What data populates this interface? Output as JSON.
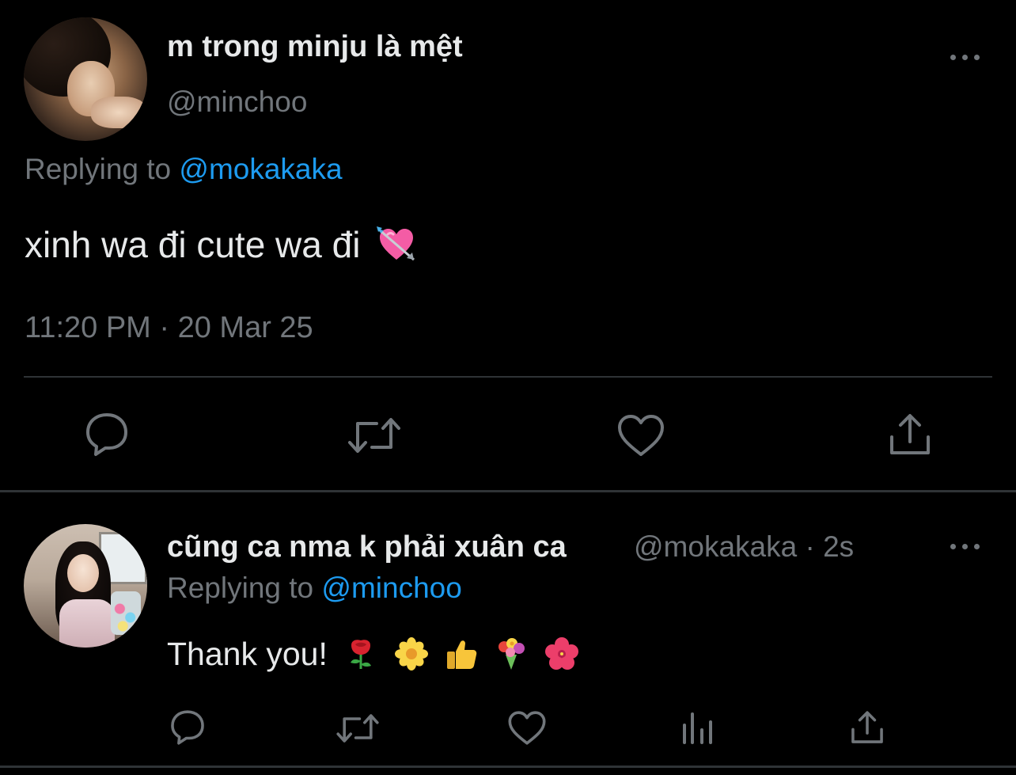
{
  "main_tweet": {
    "display_name": "m trong minju là mệt",
    "handle": "@minchoo",
    "replying_prefix": "Replying to ",
    "replying_mention": "@mokakaka",
    "text": "xinh wa đi cute wa đi",
    "emoji": "heart-with-arrow-emoji",
    "timestamp": "11:20 PM · 20 Mar 25",
    "actions": [
      "reply-icon",
      "retweet-icon",
      "like-icon",
      "share-icon"
    ]
  },
  "reply_tweet": {
    "display_name": "cũng ca nma k phải xuân ca",
    "handle_time": "@mokakaka · 2s",
    "replying_prefix": "Replying to ",
    "replying_mention": "@minchoo",
    "text": "Thank you!",
    "emojis": [
      "rose-emoji",
      "blossom-emoji",
      "thumbs-up-emoji",
      "bouquet-emoji",
      "hibiscus-emoji"
    ],
    "actions": [
      "reply-icon",
      "retweet-icon",
      "like-icon",
      "analytics-icon",
      "share-icon"
    ]
  },
  "colors": {
    "background": "#000000",
    "primary_text": "#e7e9ea",
    "secondary_text": "#71767b",
    "mention_blue": "#1d9bf0",
    "divider": "#2f3336"
  }
}
